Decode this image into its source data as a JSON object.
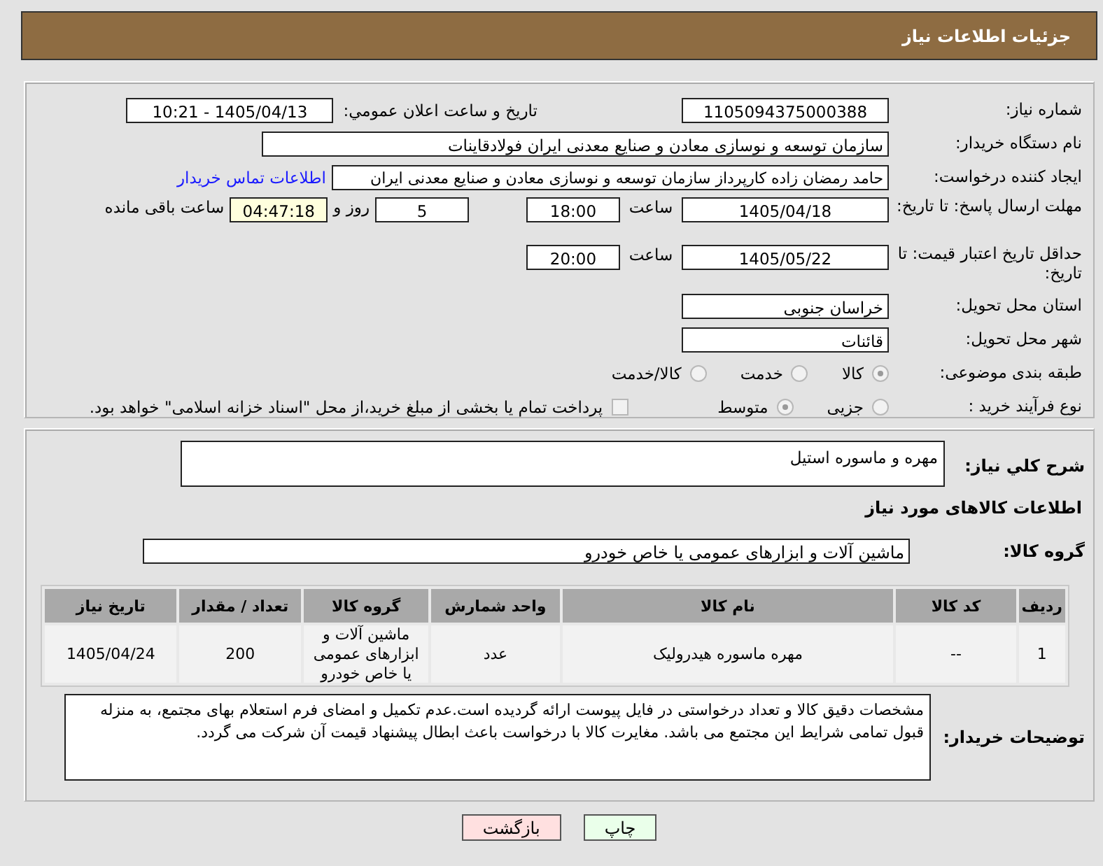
{
  "header": {
    "title": "جزئیات اطلاعات نیاز"
  },
  "need_number": {
    "label": "شماره نیاز:",
    "value": "1105094375000388"
  },
  "announce": {
    "label": "تاریخ و ساعت اعلان عمومي:",
    "value": "1405/04/13 - 10:21"
  },
  "buyer_org": {
    "label": "نام دستگاه خریدار:",
    "value": "سازمان توسعه و نوسازی معادن و صنایع معدنی ایران فولادقاینات"
  },
  "creator": {
    "label": "ایجاد کننده درخواست:",
    "value": "حامد  رمضان زاده  کارپرداز  سازمان توسعه و نوسازی معادن و صنایع معدنی ایران",
    "link": "اطلاعات تماس خریدار"
  },
  "reply_deadline": {
    "label": "مهلت ارسال پاسخ: تا تاریخ:",
    "date": "1405/04/18",
    "time_label": "ساعت",
    "time": "18:00",
    "days": "5",
    "days_label": "روز و",
    "remaining": "04:47:18",
    "remaining_label": "ساعت باقی مانده"
  },
  "price_validity": {
    "label": "حداقل تاریخ اعتبار قیمت: تا تاریخ:",
    "date": "1405/05/22",
    "time_label": "ساعت",
    "time": "20:00"
  },
  "province": {
    "label": "استان محل تحویل:",
    "value": "خراسان جنوبی"
  },
  "city": {
    "label": "شهر محل تحویل:",
    "value": "قائنات"
  },
  "category": {
    "label": "طبقه بندی موضوعی:",
    "options": [
      {
        "label": "کالا",
        "selected": true
      },
      {
        "label": "خدمت",
        "selected": false
      },
      {
        "label": "کالا/خدمت",
        "selected": false
      }
    ]
  },
  "purchase_type": {
    "label": "نوع فرآیند خرید :",
    "options": [
      {
        "label": "جزیی",
        "selected": false
      },
      {
        "label": "متوسط",
        "selected": true
      }
    ],
    "treasury": {
      "label": "پرداخت تمام یا بخشی از مبلغ خرید،از محل \"اسناد خزانه اسلامی\" خواهد بود.",
      "checked": false
    }
  },
  "description": {
    "label": "شرح کلي نياز:",
    "value": "مهره و ماسوره استیل"
  },
  "goods_title": "اطلاعات کالاهای مورد نیاز",
  "goods_group": {
    "label": "گروه کالا:",
    "value": "ماشین آلات و ابزارهای عمومی یا خاص خودرو"
  },
  "table": {
    "columns": [
      "ردیف",
      "کد کالا",
      "نام کالا",
      "واحد شمارش",
      "گروه کالا",
      "تعداد / مقدار",
      "تاریخ نیاز"
    ],
    "rows": [
      [
        "1",
        "--",
        "مهره ماسوره هیدرولیک",
        "عدد",
        "ماشین آلات و ابزارهای عمومی یا خاص خودرو",
        "200",
        "1405/04/24"
      ]
    ]
  },
  "buyer_notes": {
    "label": "توضیحات خریدار:",
    "value": "مشخصات دقیق کالا و تعداد درخواستی در فایل پیوست ارائه گردیده است.عدم تکمیل و امضای فرم استعلام بهای مجتمع، به منزله قبول تمامی شرایط این مجتمع می باشد. مغایرت کالا با درخواست باعث ابطال پیشنهاد قیمت آن شرکت می گردد."
  },
  "buttons": [
    {
      "label": "چاپ",
      "kind": "print"
    },
    {
      "label": "بازگشت",
      "kind": "back"
    }
  ]
}
